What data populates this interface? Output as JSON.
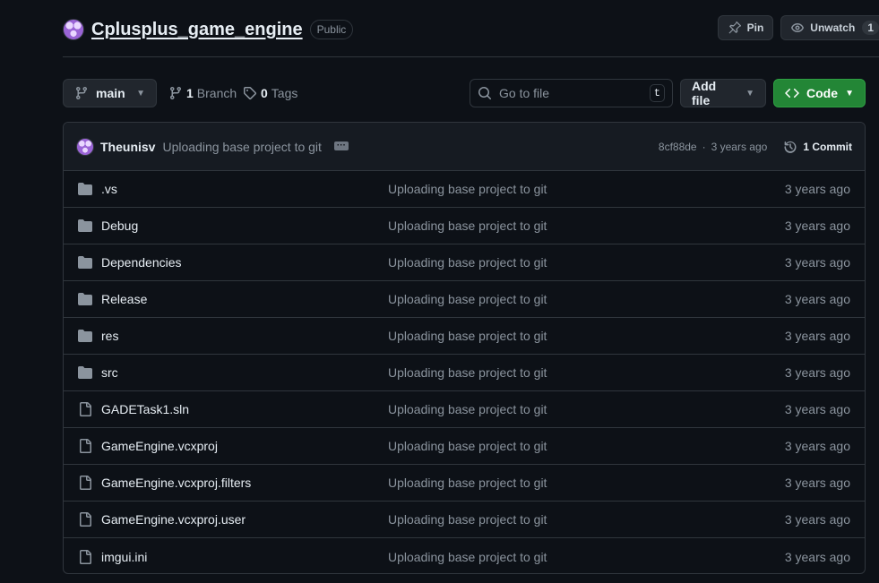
{
  "repo": {
    "name": "Cplusplus_game_engine",
    "visibility": "Public"
  },
  "actions": {
    "pin_label": "Pin",
    "watch_label": "Unwatch",
    "watch_count": "1"
  },
  "toolbar": {
    "branch": "main",
    "branch_count": "1",
    "branch_label": "Branch",
    "tag_count": "0",
    "tag_label": "Tags",
    "search_placeholder": "Go to file",
    "search_shortcut": "t",
    "add_file_label": "Add file",
    "code_label": "Code"
  },
  "commit": {
    "author": "Theunisv",
    "message": "Uploading base project to git",
    "hash": "8cf88de",
    "separator": "·",
    "age": "3 years ago",
    "commits_label": "1 Commit"
  },
  "files": [
    {
      "name": ".vs",
      "type": "folder",
      "message": "Uploading base project to git",
      "age": "3 years ago"
    },
    {
      "name": "Debug",
      "type": "folder",
      "message": "Uploading base project to git",
      "age": "3 years ago"
    },
    {
      "name": "Dependencies",
      "type": "folder",
      "message": "Uploading base project to git",
      "age": "3 years ago"
    },
    {
      "name": "Release",
      "type": "folder",
      "message": "Uploading base project to git",
      "age": "3 years ago"
    },
    {
      "name": "res",
      "type": "folder",
      "message": "Uploading base project to git",
      "age": "3 years ago"
    },
    {
      "name": "src",
      "type": "folder",
      "message": "Uploading base project to git",
      "age": "3 years ago"
    },
    {
      "name": "GADETask1.sln",
      "type": "file",
      "message": "Uploading base project to git",
      "age": "3 years ago"
    },
    {
      "name": "GameEngine.vcxproj",
      "type": "file",
      "message": "Uploading base project to git",
      "age": "3 years ago"
    },
    {
      "name": "GameEngine.vcxproj.filters",
      "type": "file",
      "message": "Uploading base project to git",
      "age": "3 years ago"
    },
    {
      "name": "GameEngine.vcxproj.user",
      "type": "file",
      "message": "Uploading base project to git",
      "age": "3 years ago"
    },
    {
      "name": "imgui.ini",
      "type": "file",
      "message": "Uploading base project to git",
      "age": "3 years ago"
    }
  ],
  "colors": {
    "background": "#0d1117",
    "border": "#30363d",
    "code_button": "#238636",
    "muted_text": "#8b949e"
  }
}
